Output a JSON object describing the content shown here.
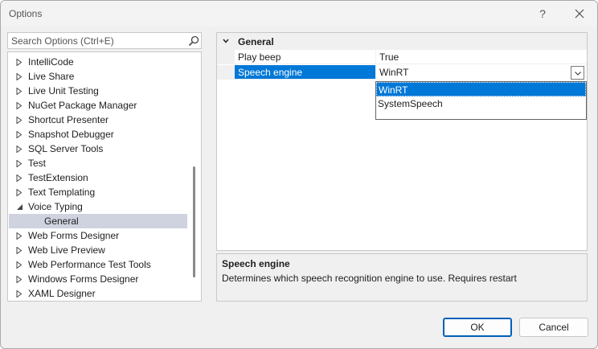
{
  "window": {
    "title": "Options",
    "help_glyph": "?",
    "close_glyph": "✕"
  },
  "search": {
    "placeholder": "Search Options (Ctrl+E)",
    "value": ""
  },
  "tree": {
    "items": [
      {
        "label": "IntelliCode",
        "expanded": false
      },
      {
        "label": "Live Share",
        "expanded": false
      },
      {
        "label": "Live Unit Testing",
        "expanded": false
      },
      {
        "label": "NuGet Package Manager",
        "expanded": false
      },
      {
        "label": "Shortcut Presenter",
        "expanded": false
      },
      {
        "label": "Snapshot Debugger",
        "expanded": false
      },
      {
        "label": "SQL Server Tools",
        "expanded": false
      },
      {
        "label": "Test",
        "expanded": false
      },
      {
        "label": "TestExtension",
        "expanded": false
      },
      {
        "label": "Text Templating",
        "expanded": false
      },
      {
        "label": "Voice Typing",
        "expanded": true
      },
      {
        "label": "General",
        "child": true,
        "selected": true
      },
      {
        "label": "Web Forms Designer",
        "expanded": false
      },
      {
        "label": "Web Live Preview",
        "expanded": false
      },
      {
        "label": "Web Performance Test Tools",
        "expanded": false
      },
      {
        "label": "Windows Forms Designer",
        "expanded": false
      },
      {
        "label": "XAML Designer",
        "expanded": false
      }
    ]
  },
  "grid": {
    "category": "General",
    "properties": [
      {
        "name": "Play beep",
        "value": "True"
      },
      {
        "name": "Speech engine",
        "value": "WinRT",
        "selected": true
      }
    ],
    "dropdown_options": [
      "WinRT",
      "SystemSpeech"
    ],
    "dropdown_highlighted": "WinRT"
  },
  "description": {
    "title": "Speech engine",
    "text": "Determines which speech recognition engine to use. Requires restart"
  },
  "buttons": {
    "ok": "OK",
    "cancel": "Cancel"
  },
  "colors": {
    "accent": "#0078d7",
    "selection_tree": "#cfd3e0"
  }
}
